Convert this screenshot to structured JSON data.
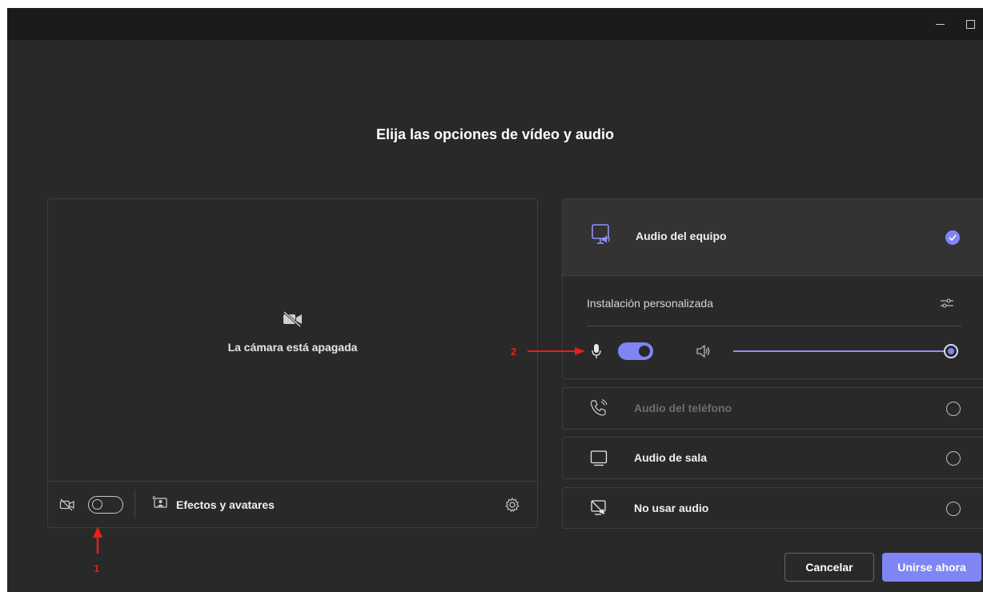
{
  "window": {
    "controls": {
      "minimize_icon": "minimize-icon",
      "maximize_icon": "maximize-icon"
    }
  },
  "heading": "Elija las opciones de vídeo y audio",
  "preview": {
    "camera_off_icon": "camera-off-icon",
    "camera_off_text": "La cámara está apagada",
    "bar": {
      "camera_toggle": {
        "icon": "camera-off-icon",
        "state": "off"
      },
      "effects_icon": "effects-icon",
      "effects_label": "Efectos y avatares",
      "settings_icon": "gear-icon"
    }
  },
  "audio_options": {
    "equipo": {
      "icon": "computer-audio-icon",
      "label": "Audio del equipo",
      "selected": true,
      "custom_label": "Instalación personalizada",
      "settings_icon": "sliders-icon",
      "mic_icon": "microphone-icon",
      "mic_state": "on",
      "speaker_icon": "speaker-icon",
      "volume_fraction": 1.0
    },
    "telefono": {
      "icon": "phone-icon",
      "label": "Audio del teléfono",
      "selected": false,
      "disabled": true
    },
    "sala": {
      "icon": "room-audio-icon",
      "label": "Audio de sala",
      "selected": false
    },
    "no_audio": {
      "icon": "no-audio-icon",
      "label": "No usar audio",
      "selected": false
    }
  },
  "footer": {
    "cancel_label": "Cancelar",
    "join_label": "Unirse ahora"
  },
  "annotations": {
    "marker_1": "1",
    "marker_2": "2"
  },
  "colors": {
    "accent": "#7f85f5",
    "background": "#292929",
    "titlebar": "#1b1b1b",
    "annotation": "#e5201a"
  }
}
